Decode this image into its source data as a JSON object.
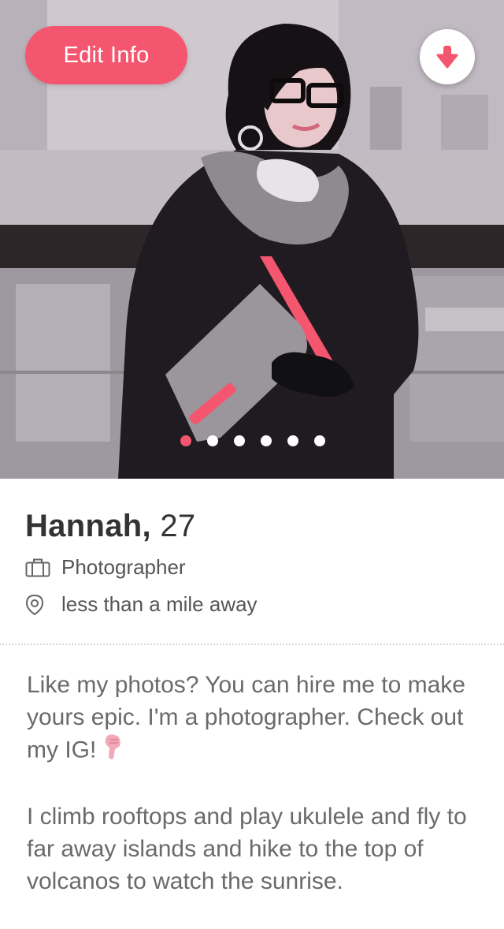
{
  "profile": {
    "name": "Hannah,",
    "age": "27",
    "job": "Photographer",
    "distance": "less than a mile away"
  },
  "actions": {
    "edit_label": "Edit Info"
  },
  "photo": {
    "page_count": 6,
    "active_index": 0
  },
  "bio": {
    "paragraph1": "Like my photos? You can hire me to make yours epic. I'm a photographer. Check out my IG!",
    "paragraph2": "I climb rooftops and play ukulele and fly to far away islands and hike to the top of volcanos to watch the sunrise."
  },
  "icons": {
    "download": "arrow-down-icon",
    "job": "briefcase-icon",
    "location": "location-pin-icon",
    "pointing": "pointing-down-icon"
  },
  "colors": {
    "accent": "#f5566f",
    "name_text": "#333333",
    "body_text": "#6a6a6a"
  }
}
